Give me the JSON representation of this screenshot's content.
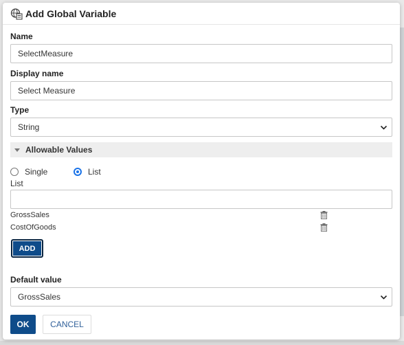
{
  "dialog": {
    "title": "Add Global Variable",
    "icon": "global-variable-icon"
  },
  "form": {
    "name": {
      "label": "Name",
      "value": "SelectMeasure"
    },
    "display_name": {
      "label": "Display name",
      "value": "Select Measure"
    },
    "type": {
      "label": "Type",
      "value": "String"
    },
    "allowable": {
      "section_label": "Allowable Values",
      "options": [
        "Single",
        "List"
      ],
      "selected": "List",
      "list_label": "List",
      "list_input_value": "",
      "items": [
        "GrossSales",
        "CostOfGoods"
      ],
      "add_label": "ADD"
    },
    "default_value": {
      "label": "Default value",
      "value": "GrossSales"
    }
  },
  "buttons": {
    "ok": "OK",
    "cancel": "CANCEL"
  },
  "colors": {
    "primary": "#0f4c8a",
    "radio_selected": "#1a73e8",
    "link": "#2f5f99"
  }
}
